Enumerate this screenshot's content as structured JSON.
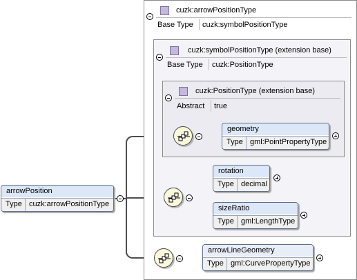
{
  "root_element": {
    "name": "arrowPosition",
    "type_label": "Type",
    "type_value": "cuzk:arrowPositionType"
  },
  "complex_type": {
    "name": "cuzk:arrowPositionType",
    "base_label": "Base Type",
    "base_value": "cuzk:symbolPositionType",
    "extension": {
      "name": "cuzk:symbolPositionType (extension base)",
      "base_label": "Base Type",
      "base_value": "cuzk:PositionType",
      "extension": {
        "name": "cuzk:PositionType (extension base)",
        "abstract_label": "Abstract",
        "abstract_value": "true"
      }
    }
  },
  "elements": {
    "geometry": {
      "name": "geometry",
      "type_label": "Type",
      "type_value": "gml:PointPropertyType"
    },
    "rotation": {
      "name": "rotation",
      "type_label": "Type",
      "type_value": "decimal"
    },
    "sizeRatio": {
      "name": "sizeRatio",
      "type_label": "Type",
      "type_value": "gml:LengthType"
    },
    "arrowLineGeometry": {
      "name": "arrowLineGeometry",
      "type_label": "Type",
      "type_value": "gml:CurvePropertyType"
    }
  },
  "icons": [
    "complex-type-icon",
    "sequence-compositor-icon",
    "collapse-icon",
    "expand-icon"
  ],
  "colors": {
    "element_header": "#dce8f8",
    "element_border": "#5a6f8c",
    "compositor_fill": "#fbf8dc",
    "type_icon": "#c4b9dc"
  }
}
